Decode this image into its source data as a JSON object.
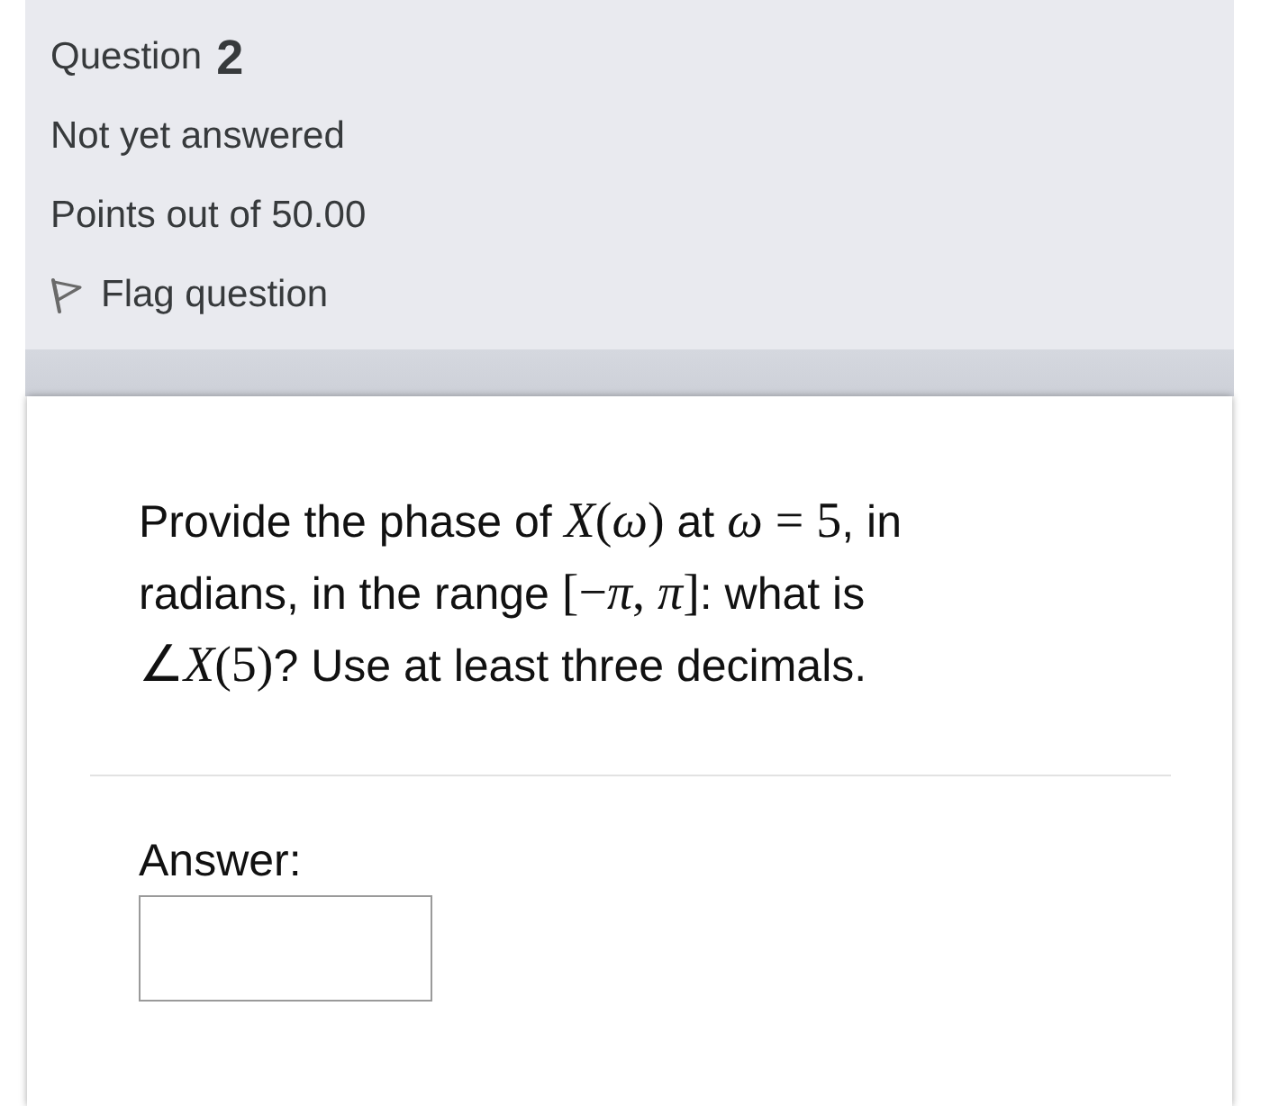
{
  "question_info": {
    "label": "Question",
    "number": "2",
    "status": "Not yet answered",
    "points": "Points out of 50.00",
    "flag": {
      "label": "Flag question",
      "flagged": false
    }
  },
  "question": {
    "segments": [
      {
        "kind": "text",
        "text": "Provide the phase of "
      },
      {
        "kind": "math",
        "text": "*X*(*ω*)"
      },
      {
        "kind": "text",
        "text": " at "
      },
      {
        "kind": "math",
        "text": "*ω* = 5"
      },
      {
        "kind": "text",
        "text": ", in radians, in the range "
      },
      {
        "kind": "math",
        "text": "[−*π*, *π*]"
      },
      {
        "kind": "text",
        "text": ": what is "
      },
      {
        "kind": "math",
        "text": "∠*X*(5)"
      },
      {
        "kind": "text",
        "text": "? Use at least three decimals."
      }
    ]
  },
  "answer": {
    "label": "Answer:"
  }
}
